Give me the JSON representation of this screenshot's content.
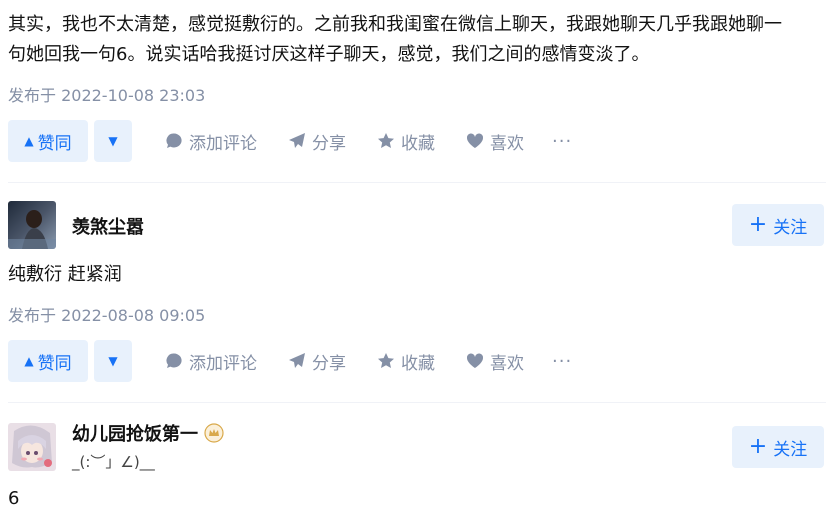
{
  "answers": [
    {
      "content": [
        "其实，我也不太清楚，感觉挺敷衍的。之前我和我闺蜜在微信上聊天，我跟她聊天几乎我跟她聊一",
        "句她回我一句6。说实话哈我挺讨厌这样子聊天，感觉，我们之间的感情变淡了。"
      ],
      "published": "发布于 2022-10-08 23:03"
    },
    {
      "author": "羡煞尘嚣",
      "follow_label": "关注",
      "content": [
        "纯敷衍 赶紧润"
      ],
      "published": "发布于 2022-08-08 09:05"
    },
    {
      "author": "幼儿园抢饭第一",
      "bio": "_(:︶」∠)__",
      "follow_label": "关注",
      "content": [
        "6"
      ]
    }
  ],
  "actions": {
    "upvote": "赞同",
    "comment": "添加评论",
    "share": "分享",
    "collect": "收藏",
    "like": "喜欢",
    "more": "···"
  },
  "colors": {
    "accent": "#1772f6",
    "accent_bg": "#e8f1fc",
    "meta": "#8590a6",
    "badge": "#d9a94b"
  }
}
